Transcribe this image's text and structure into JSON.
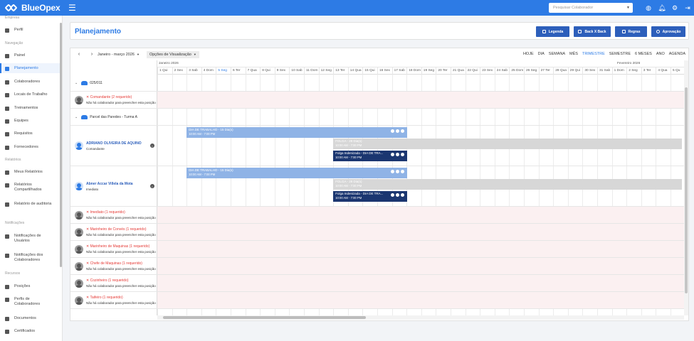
{
  "topbar": {
    "brand": "BlueOpex",
    "search_placeholder": "Pesquisar Colaborador"
  },
  "sidebar": {
    "sections": [
      {
        "heading": "Empresa",
        "items": [
          "Perfil"
        ]
      },
      {
        "heading": "Navegação",
        "items": [
          "Painel",
          "Planejamento",
          "Colaboradores",
          "Locais de Trabalho",
          "Treinamentos",
          "Equipes",
          "Requisitos",
          "Fornecedores"
        ]
      },
      {
        "heading": "Relatórios",
        "items": [
          "Meus Relatórios",
          "Relatórios Compartilhados",
          "Relatório de auditoria"
        ]
      },
      {
        "heading": "Notificações",
        "items": [
          "Notificações de Usuários",
          "Notificações dos Colaboradores"
        ]
      },
      {
        "heading": "Recursos",
        "items": [
          "Posições",
          "Perfis de Colaboradores",
          "Documentos",
          "Certificados"
        ]
      }
    ],
    "active": "Planejamento"
  },
  "header": {
    "title": "Planejamento",
    "buttons": [
      "Legenda",
      "Back X Back",
      "Regras",
      "Aprovação"
    ]
  },
  "calendar": {
    "range_label": "Janeiro - março 2026",
    "options_label": "Opções de Visualização",
    "views": [
      "HOJE",
      "DIA",
      "SEMANA",
      "MÊS",
      "TRIMESTRE",
      "SEMESTRE",
      "6 MESES",
      "ANO",
      "AGENDA"
    ],
    "active_view": "TRIMESTRE",
    "months": [
      "Janeiro 2026",
      "Fevereiro 2026"
    ],
    "days": [
      "1 Qui",
      "2 Sex",
      "3 Sab",
      "4 Dom",
      "5 Seg",
      "6 Ter",
      "7 Qua",
      "8 Qui",
      "9 Sex",
      "10 Sab",
      "11 Dom",
      "12 Seg",
      "13 Ter",
      "14 Qua",
      "15 Qui",
      "16 Sex",
      "17 Sab",
      "18 Dom",
      "19 Seg",
      "20 Ter",
      "21 Qua",
      "22 Qui",
      "23 Sex",
      "24 Sab",
      "25 Dom",
      "26 Seg",
      "27 Ter",
      "28 Qua",
      "29 Qui",
      "30 Sex",
      "31 Sab",
      "1 Dom",
      "2 Seg",
      "3 Ter",
      "4 Qua",
      "5 Qu"
    ],
    "today_index": 4,
    "rows": [
      {
        "type": "group",
        "label": "025/011"
      },
      {
        "type": "req",
        "title": "Comandante (2 requerido)",
        "note": "Não há colaborador para preencher esta posição"
      },
      {
        "type": "group",
        "label": "Parcel das Paredes - Turma A"
      },
      {
        "type": "emp",
        "name": "ADRIANO OLIVEIRA DE AQUINO",
        "role": "Comandante"
      },
      {
        "type": "emp",
        "name": "Abner Accar Villela da Mota",
        "role": "Imediato"
      },
      {
        "type": "req",
        "title": "Imediato (1 requerido)",
        "note": "Não há colaborador para preencher esta posição"
      },
      {
        "type": "req",
        "title": "Marinheiro de Convés (1 requerido)",
        "note": "Não há colaborador para preencher esta posição"
      },
      {
        "type": "req",
        "title": "Marinheiro de Maquinas (1 requerido)",
        "note": "Não há colaborador para preencher esta posição"
      },
      {
        "type": "req",
        "title": "Chefe de Maquinas (1 requerido)",
        "note": "Não há colaborador para preencher esta posição"
      },
      {
        "type": "req",
        "title": "Cozinheiro (1 requerido)",
        "note": "Não há colaborador para preencher esta posição"
      },
      {
        "type": "req",
        "title": "Taifeiro (1 requerido)",
        "note": "Não há colaborador para preencher esta posição"
      }
    ],
    "events": {
      "work": {
        "title": "DIA DE TRABALHO - 15 Dia(s)",
        "time": "10:00 AM - 7:00 PM"
      },
      "folga": {
        "title": "FOLGA - 28 Dia(s)",
        "time": "10:00 AM - 7:00 PM"
      },
      "indenizada": {
        "title": "Folga Indenizada - DIA DE TRA...",
        "time": "10:00 AM - 7:00 PM"
      }
    }
  },
  "colors": {
    "accent": "#2d7be5",
    "button": "#2d5fbb",
    "required": "#e53935",
    "work": "#8fb3e6",
    "folga": "#d7d7d7",
    "indenizada": "#1b3670"
  }
}
